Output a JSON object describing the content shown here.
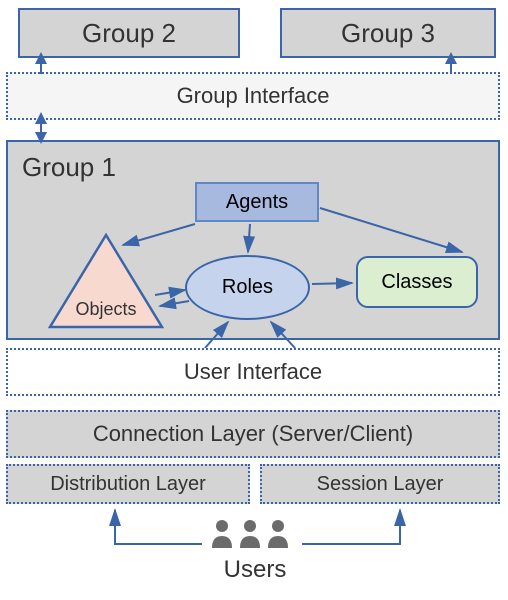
{
  "groups": {
    "group2_label": "Group 2",
    "group3_label": "Group 3",
    "group1_label": "Group 1"
  },
  "interfaces": {
    "group_interface_label": "Group Interface",
    "user_interface_label": "User Interface"
  },
  "inner": {
    "agents_label": "Agents",
    "roles_label": "Roles",
    "classes_label": "Classes",
    "objects_label": "Objects"
  },
  "layers": {
    "connection_label": "Connection Layer (Server/Client)",
    "distribution_label": "Distribution Layer",
    "session_label": "Session Layer"
  },
  "users_label": "Users"
}
